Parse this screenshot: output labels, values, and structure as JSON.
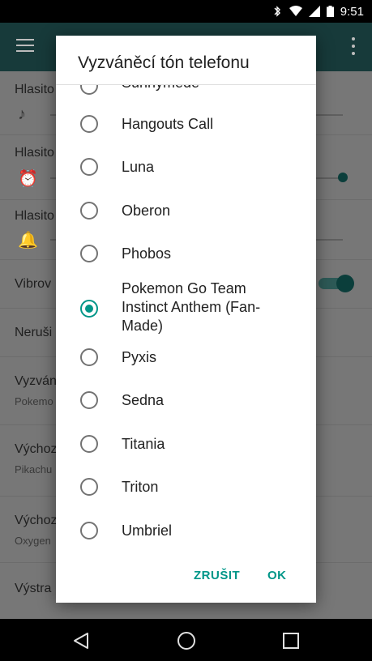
{
  "status_bar": {
    "time": "9:51",
    "icons": [
      "bluetooth-icon",
      "wifi-icon",
      "signal-icon",
      "battery-icon"
    ]
  },
  "background_settings": {
    "rows": [
      {
        "title": "Hlasito",
        "icon": "music-note-icon"
      },
      {
        "title": "Hlasito",
        "icon": "alarm-icon"
      },
      {
        "title": "Hlasito",
        "icon": "bell-icon"
      },
      {
        "title": "Vibrov"
      },
      {
        "title": "Neruši"
      },
      {
        "title": "Vyzván",
        "subtitle": "Pokemo"
      },
      {
        "title": "Výchoz",
        "subtitle": "Pikachu"
      },
      {
        "title": "Výchoz",
        "subtitle": "Oxygen"
      },
      {
        "title": "Výstra"
      }
    ]
  },
  "dialog": {
    "title": "Vyzváněcí tón telefonu",
    "partial_item": "Sunnymede",
    "options": [
      {
        "label": "Hangouts Call",
        "selected": false
      },
      {
        "label": "Luna",
        "selected": false
      },
      {
        "label": "Oberon",
        "selected": false
      },
      {
        "label": "Phobos",
        "selected": false
      },
      {
        "label": "Pokemon Go Team Instinct Anthem (Fan-Made)",
        "selected": true
      },
      {
        "label": "Pyxis",
        "selected": false
      },
      {
        "label": "Sedna",
        "selected": false
      },
      {
        "label": "Titania",
        "selected": false
      },
      {
        "label": "Triton",
        "selected": false
      },
      {
        "label": "Umbriel",
        "selected": false
      }
    ],
    "cancel_label": "ZRUŠIT",
    "ok_label": "OK"
  },
  "colors": {
    "accent": "#009688",
    "scrim_background": "#7a7a7a",
    "appbar_dimmed": "#173a3a"
  },
  "nav_bar": {
    "icons": [
      "back-icon",
      "home-icon",
      "recents-icon"
    ]
  }
}
